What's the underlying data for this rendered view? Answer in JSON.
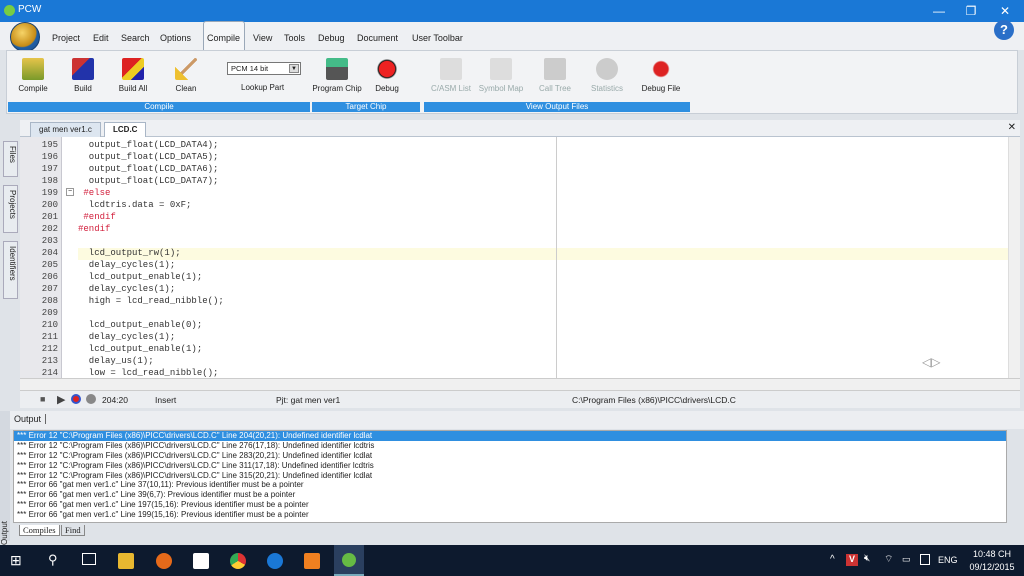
{
  "window": {
    "title": "PCW",
    "minimize": "—",
    "maximize": "❐",
    "close": "✕"
  },
  "menu": [
    "Project",
    "Edit",
    "Search",
    "Options",
    "Compile",
    "View",
    "Tools",
    "Debug",
    "Document",
    "User Toolbar"
  ],
  "help": "?",
  "ribbon": {
    "compile_group": {
      "label": "Compile",
      "buttons": [
        "Compile",
        "Build",
        "Build All",
        "Clean"
      ],
      "part_select": "PCM 14 bit",
      "lookup": "Lookup Part"
    },
    "target_group": {
      "label": "Target Chip",
      "buttons": [
        "Program Chip",
        "Debug"
      ]
    },
    "output_group": {
      "label": "View Output Files",
      "buttons": [
        "C/ASM List",
        "Symbol Map",
        "Call Tree",
        "Statistics",
        "Debug File"
      ]
    }
  },
  "editor_tabs": [
    "gat men ver1.c",
    "LCD.C"
  ],
  "side_tabs": [
    "Files",
    "Projects",
    "Identifiers"
  ],
  "code": [
    {
      "n": "195",
      "t": "  output_float(LCD_DATA4);",
      "k": ""
    },
    {
      "n": "196",
      "t": "  output_float(LCD_DATA5);",
      "k": ""
    },
    {
      "n": "197",
      "t": "  output_float(LCD_DATA6);",
      "k": ""
    },
    {
      "n": "198",
      "t": "  output_float(LCD_DATA7);",
      "k": ""
    },
    {
      "n": "199",
      "t": " #else",
      "k": "pp"
    },
    {
      "n": "200",
      "t": "  lcdtris.data = 0xF;",
      "k": ""
    },
    {
      "n": "201",
      "t": " #endif",
      "k": "pp"
    },
    {
      "n": "202",
      "t": "#endif",
      "k": "pp"
    },
    {
      "n": "203",
      "t": "",
      "k": ""
    },
    {
      "n": "204",
      "t": "  lcd_output_rw(1);",
      "k": ""
    },
    {
      "n": "205",
      "t": "  delay_cycles(1);",
      "k": ""
    },
    {
      "n": "206",
      "t": "  lcd_output_enable(1);",
      "k": ""
    },
    {
      "n": "207",
      "t": "  delay_cycles(1);",
      "k": ""
    },
    {
      "n": "208",
      "t": "  high = lcd_read_nibble();",
      "k": ""
    },
    {
      "n": "209",
      "t": "",
      "k": ""
    },
    {
      "n": "210",
      "t": "  lcd_output_enable(0);",
      "k": ""
    },
    {
      "n": "211",
      "t": "  delay_cycles(1);",
      "k": ""
    },
    {
      "n": "212",
      "t": "  lcd_output_enable(1);",
      "k": ""
    },
    {
      "n": "213",
      "t": "  delay_us(1);",
      "k": ""
    },
    {
      "n": "214",
      "t": "  low = lcd_read_nibble();",
      "k": ""
    }
  ],
  "status": {
    "position": "204:20",
    "mode": "Insert",
    "project": "Pjt: gat men ver1",
    "path": "C:\\Program Files (x86)\\PICC\\drivers\\LCD.C"
  },
  "output": {
    "tab": "Output",
    "side_label": "Output",
    "errors": [
      "*** Error 12 \"C:\\Program Files (x86)\\PICC\\drivers\\LCD.C\" Line 204(20,21): Undefined identifier   lcdlat",
      "*** Error 12 \"C:\\Program Files (x86)\\PICC\\drivers\\LCD.C\" Line 276(17,18): Undefined identifier   lcdtris",
      "*** Error 12 \"C:\\Program Files (x86)\\PICC\\drivers\\LCD.C\" Line 283(20,21): Undefined identifier   lcdlat",
      "*** Error 12 \"C:\\Program Files (x86)\\PICC\\drivers\\LCD.C\" Line 311(17,18): Undefined identifier   lcdtris",
      "*** Error 12 \"C:\\Program Files (x86)\\PICC\\drivers\\LCD.C\" Line 315(20,21): Undefined identifier   lcdlat",
      "*** Error 66 \"gat men ver1.c\" Line 37(10,11): Previous identifier must be a pointer",
      "*** Error 66 \"gat men ver1.c\" Line 39(6,7): Previous identifier must be a pointer",
      "*** Error 66 \"gat men ver1.c\" Line 197(15,16): Previous identifier must be a pointer",
      "*** Error 66 \"gat men ver1.c\" Line 199(15,16): Previous identifier must be a pointer"
    ],
    "bottom_tabs": [
      "Compiles",
      "Find"
    ]
  },
  "taskbar": {
    "lang": "ENG",
    "time": "10:48 CH",
    "date": "09/12/2015"
  }
}
